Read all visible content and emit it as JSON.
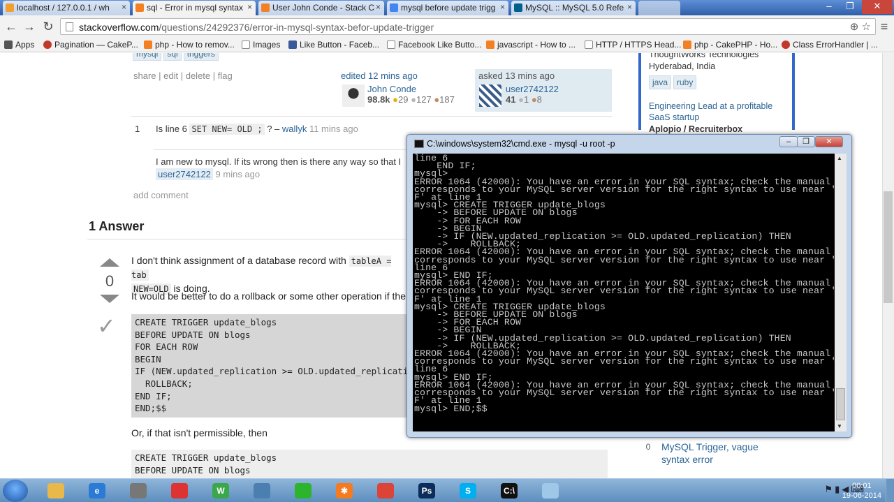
{
  "browser": {
    "tabs": [
      {
        "label": "localhost / 127.0.0.1 / wh",
        "icon": "phpmyadmin-icon",
        "color": "#f0a030"
      },
      {
        "label": "sql - Error in mysql syntax",
        "icon": "stackoverflow-icon",
        "color": "#f48024"
      },
      {
        "label": "User John Conde - Stack C",
        "icon": "stackoverflow-icon",
        "color": "#f48024"
      },
      {
        "label": "mysql before update trigg",
        "icon": "google-icon",
        "color": "#4285f4"
      },
      {
        "label": "MySQL :: MySQL 5.0 Refe",
        "icon": "mysql-icon",
        "color": "#00618a"
      }
    ],
    "url_host": "stackoverflow.com",
    "url_path": "/questions/24292376/error-in-mysql-syntax-befor-update-trigger",
    "bookmarks": [
      {
        "label": "Apps",
        "color": "#555"
      },
      {
        "label": "Pagination — CakeP...",
        "color": "#c0392b"
      },
      {
        "label": "php - How to remov...",
        "color": "#f48024"
      },
      {
        "label": "Images",
        "color": "#888"
      },
      {
        "label": "Like Button - Faceb...",
        "color": "#3b5998"
      },
      {
        "label": "Facebook Like Butto...",
        "color": "#888"
      },
      {
        "label": "javascript - How to ...",
        "color": "#f48024"
      },
      {
        "label": "HTTP / HTTPS Head...",
        "color": "#888"
      },
      {
        "label": "php - CakePHP - Ho...",
        "color": "#f48024"
      },
      {
        "label": "Class ErrorHandler | ...",
        "color": "#c0392b"
      }
    ]
  },
  "question": {
    "tags": [
      "mysql",
      "sql",
      "triggers"
    ],
    "menu": [
      "share",
      "edit",
      "delete",
      "flag"
    ],
    "edited": {
      "action": "edited 12 mins ago",
      "user": "John Conde",
      "rep": "98.8k",
      "gold": "29",
      "silver": "127",
      "bronze": "187"
    },
    "asked": {
      "action": "asked 13 mins ago",
      "user": "user2742122",
      "rep": "41",
      "silver": "1",
      "bronze": "8"
    },
    "comments": [
      {
        "score": "1",
        "pre": "Is line 6",
        "code": "SET NEW= OLD ;",
        "post": "? –",
        "user": "wallyk",
        "time": "11 mins ago"
      },
      {
        "score": "",
        "text": "I am new to mysql. If its wrong then is there any way so that I",
        "user": "user2742122",
        "time": "9 mins ago"
      }
    ],
    "add_comment": "add comment"
  },
  "answers": {
    "header": "1 Answer",
    "vote_count": "0",
    "p1_pre": "I don't think assignment of a database record with",
    "p1_code": "tableA = tab",
    "p1_code2": "NEW=OLD",
    "p1_post": "is doing.",
    "p2": "It would be better to do a rollback or some other operation if the u",
    "code1": "CREATE TRIGGER update_blogs\nBEFORE UPDATE ON blogs\nFOR EACH ROW\nBEGIN\nIF (NEW.updated_replication >= OLD.updated_replicati\n  ROLLBACK;\nEND IF;\nEND;$$",
    "p3": "Or, if that isn't permissible, then",
    "code2": "CREATE TRIGGER update_blogs\nBEFORE UPDATE ON blogs"
  },
  "sidebar": {
    "company_top": "ThoughtWorks Technologies",
    "location": "Hyderabad, India",
    "job_tags": [
      "java",
      "ruby"
    ],
    "job_title": "Engineering Lead at a profitable SaaS startup",
    "job_company": "Aplopio / Recruiterbox",
    "related_count": "0",
    "related_title": "MySQL Trigger, vague syntax error"
  },
  "cmd": {
    "title": "C:\\windows\\system32\\cmd.exe - mysql  -u root -p",
    "output": "line 6\n    END IF;\nmysql>\nERROR 1064 (42000): You have an error in your SQL syntax; check the manual that\ncorresponds to your MySQL server version for the right syntax to use near 'END I\nF' at line 1\nmysql> CREATE TRIGGER update_blogs\n    -> BEFORE UPDATE ON blogs\n    -> FOR EACH ROW\n    -> BEGIN\n    -> IF (NEW.updated_replication >= OLD.updated_replication) THEN\n    ->    ROLLBACK;\nERROR 1064 (42000): You have an error in your SQL syntax; check the manual that\ncorresponds to your MySQL server version for the right syntax to use near '' at\nline 6\nmysql> END IF;\nERROR 1064 (42000): You have an error in your SQL syntax; check the manual that\ncorresponds to your MySQL server version for the right syntax to use near 'END I\nF' at line 1\nmysql> CREATE TRIGGER update_blogs\n    -> BEFORE UPDATE ON blogs\n    -> FOR EACH ROW\n    -> BEGIN\n    -> IF (NEW.updated_replication >= OLD.updated_replication) THEN\n    ->    ROLLBACK;\nERROR 1064 (42000): You have an error in your SQL syntax; check the manual that\ncorresponds to your MySQL server version for the right syntax to use near '' at\nline 6\nmysql> END IF;\nERROR 1064 (42000): You have an error in your SQL syntax; check the manual that\ncorresponds to your MySQL server version for the right syntax to use near 'END I\nF' at line 1\nmysql> END;$$"
  },
  "taskbar": {
    "items": [
      {
        "name": "explorer-icon",
        "color": "#e8b84a",
        "glyph": ""
      },
      {
        "name": "ie-icon",
        "color": "#2b7bd6",
        "glyph": "e"
      },
      {
        "name": "clock-app-icon",
        "color": "#777",
        "glyph": ""
      },
      {
        "name": "pin-icon",
        "color": "#d33",
        "glyph": ""
      },
      {
        "name": "word-icon",
        "color": "#3aa84a",
        "glyph": "W"
      },
      {
        "name": "gauge-icon",
        "color": "#4a7fb0",
        "glyph": ""
      },
      {
        "name": "green-ball-icon",
        "color": "#2cb52c",
        "glyph": ""
      },
      {
        "name": "xampp-icon",
        "color": "#f47b20",
        "glyph": "✱"
      },
      {
        "name": "chrome-icon",
        "color": "#db4437",
        "glyph": ""
      },
      {
        "name": "photoshop-icon",
        "color": "#0c2c5a",
        "glyph": "Ps"
      },
      {
        "name": "skype-icon",
        "color": "#00aff0",
        "glyph": "S"
      },
      {
        "name": "cmd-icon",
        "color": "#111",
        "glyph": "C:\\"
      },
      {
        "name": "notepad-icon",
        "color": "#9ec7e8",
        "glyph": ""
      }
    ],
    "time": "00:01",
    "date": "19-06-2014"
  }
}
